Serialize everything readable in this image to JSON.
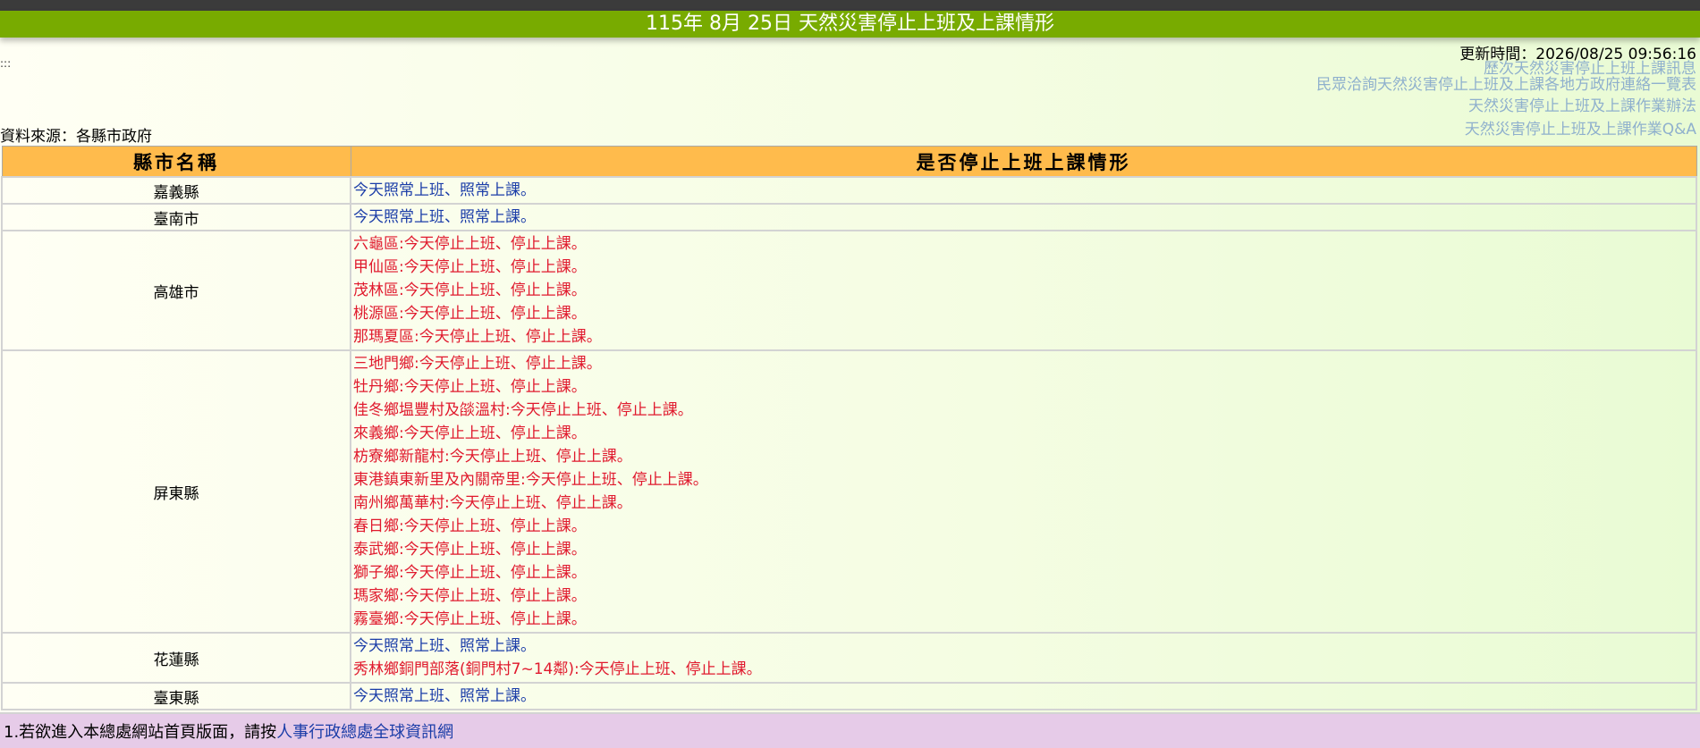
{
  "page": {
    "title": "115年 8月 25日 天然災害停止上班及上課情形",
    "update_label": "更新時間：2026/08/25 09:56:16",
    "anchor": ":::",
    "source": "資料來源：各縣市政府",
    "links": [
      "歷次天然災害停止上班上課訊息",
      "民眾洽詢天然災害停止上班及上課各地方政府連絡一覽表",
      "天然災害停止上班及上課作業辦法",
      "天然災害停止上班及上課作業Q&A"
    ]
  },
  "table": {
    "headers": [
      "縣市名稱",
      "是否停止上班上課情形"
    ],
    "rows": [
      {
        "county": "嘉義縣",
        "lines": [
          {
            "text": "今天照常上班、照常上課。",
            "type": "ok"
          }
        ]
      },
      {
        "county": "臺南市",
        "lines": [
          {
            "text": "今天照常上班、照常上課。",
            "type": "ok"
          }
        ]
      },
      {
        "county": "高雄市",
        "lines": [
          {
            "text": "六龜區:今天停止上班、停止上課。",
            "type": "stop"
          },
          {
            "text": "甲仙區:今天停止上班、停止上課。",
            "type": "stop"
          },
          {
            "text": "茂林區:今天停止上班、停止上課。",
            "type": "stop"
          },
          {
            "text": "桃源區:今天停止上班、停止上課。",
            "type": "stop"
          },
          {
            "text": "那瑪夏區:今天停止上班、停止上課。",
            "type": "stop"
          }
        ]
      },
      {
        "county": "屏東縣",
        "lines": [
          {
            "text": "三地門鄉:今天停止上班、停止上課。",
            "type": "stop"
          },
          {
            "text": "牡丹鄉:今天停止上班、停止上課。",
            "type": "stop"
          },
          {
            "text": "佳冬鄉塭豐村及燄溫村:今天停止上班、停止上課。",
            "type": "stop"
          },
          {
            "text": "來義鄉:今天停止上班、停止上課。",
            "type": "stop"
          },
          {
            "text": "枋寮鄉新龍村:今天停止上班、停止上課。",
            "type": "stop"
          },
          {
            "text": "東港鎮東新里及內關帝里:今天停止上班、停止上課。",
            "type": "stop"
          },
          {
            "text": "南州鄉萬華村:今天停止上班、停止上課。",
            "type": "stop"
          },
          {
            "text": "春日鄉:今天停止上班、停止上課。",
            "type": "stop"
          },
          {
            "text": "泰武鄉:今天停止上班、停止上課。",
            "type": "stop"
          },
          {
            "text": "獅子鄉:今天停止上班、停止上課。",
            "type": "stop"
          },
          {
            "text": "瑪家鄉:今天停止上班、停止上課。",
            "type": "stop"
          },
          {
            "text": "霧臺鄉:今天停止上班、停止上課。",
            "type": "stop"
          }
        ]
      },
      {
        "county": "花蓮縣",
        "lines": [
          {
            "text": "今天照常上班、照常上課。",
            "type": "ok"
          },
          {
            "text": "秀林鄉銅門部落(銅門村7~14鄰):今天停止上班、停止上課。",
            "type": "stop"
          }
        ]
      },
      {
        "county": "臺東縣",
        "lines": [
          {
            "text": "今天照常上班、照常上課。",
            "type": "ok"
          }
        ]
      }
    ]
  },
  "footer": {
    "text": "1.若欲進入本總處網站首頁版面，請按",
    "link": "人事行政總處全球資訊網"
  },
  "colors": {
    "title_bar": "#78ab00",
    "header_row": "#ffbb4c",
    "normal_text": "#1b3da8",
    "stop_text": "#e0192d",
    "footer_bg": "#e6cbe8",
    "link": "#8fb0cd"
  }
}
